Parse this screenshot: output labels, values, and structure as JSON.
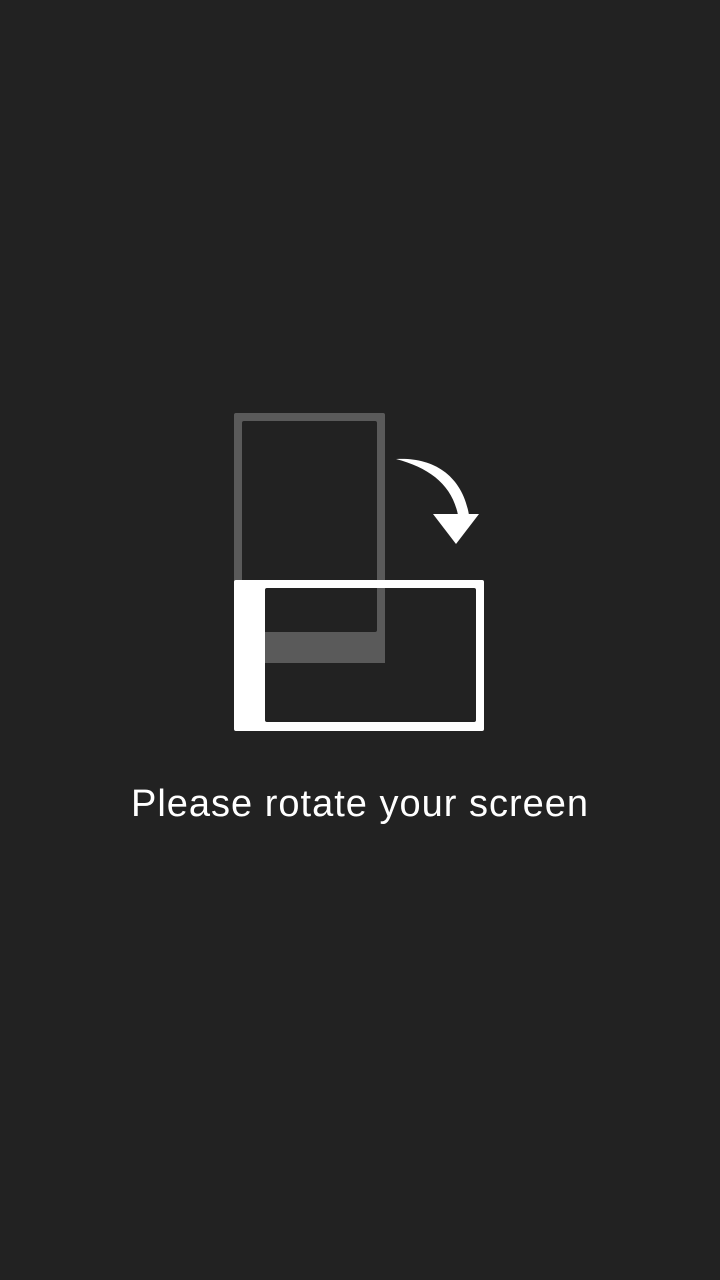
{
  "message": "Please rotate your screen",
  "icons": {
    "illustration": "rotate-device-icon",
    "portrait": "portrait-phone-icon",
    "landscape": "landscape-phone-icon",
    "arrow": "curved-arrow-icon"
  },
  "colors": {
    "background": "#222222",
    "foreground": "#ffffff",
    "portrait_outline": "#5a5a5a"
  }
}
